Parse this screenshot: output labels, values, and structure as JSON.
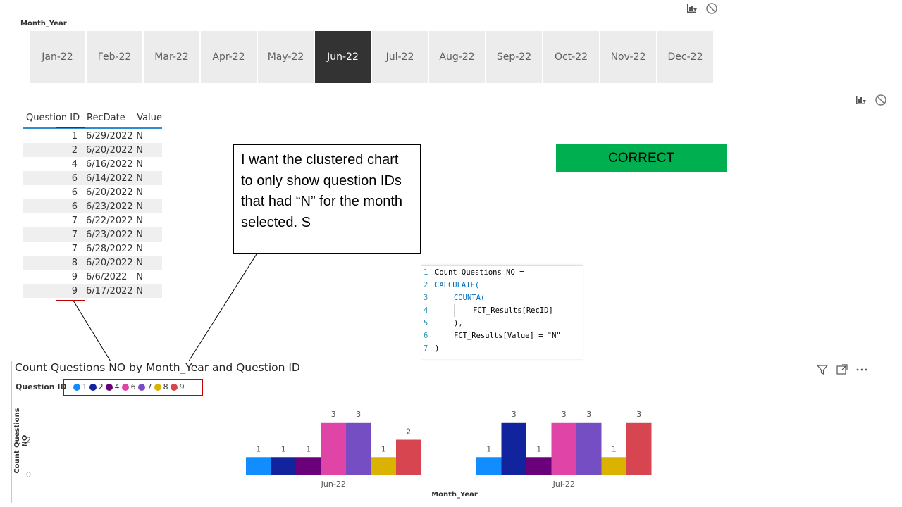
{
  "slicer": {
    "title": "Month_Year",
    "selected": "Jun-22",
    "months": [
      "Jan-22",
      "Feb-22",
      "Mar-22",
      "Apr-22",
      "May-22",
      "Jun-22",
      "Jul-22",
      "Aug-22",
      "Sep-22",
      "Oct-22",
      "Nov-22",
      "Dec-22"
    ]
  },
  "table": {
    "headers": [
      "Question ID",
      "RecDate",
      "Value"
    ],
    "rows": [
      [
        "1",
        "6/29/2022",
        "N"
      ],
      [
        "2",
        "6/20/2022",
        "N"
      ],
      [
        "4",
        "6/16/2022",
        "N"
      ],
      [
        "6",
        "6/14/2022",
        "N"
      ],
      [
        "6",
        "6/20/2022",
        "N"
      ],
      [
        "6",
        "6/23/2022",
        "N"
      ],
      [
        "7",
        "6/22/2022",
        "N"
      ],
      [
        "7",
        "6/23/2022",
        "N"
      ],
      [
        "7",
        "6/28/2022",
        "N"
      ],
      [
        "8",
        "6/20/2022",
        "N"
      ],
      [
        "9",
        "6/6/2022",
        "N"
      ],
      [
        "9",
        "6/17/2022",
        "N"
      ]
    ]
  },
  "callout": {
    "text": "I want the clustered chart to only show question IDs that had “N” for the month selected. S"
  },
  "badge": {
    "label": "CORRECT",
    "color": "#00b050"
  },
  "code": {
    "lines": [
      {
        "num": "1",
        "text": "Count Questions NO ="
      },
      {
        "num": "2",
        "text": "CALCULATE("
      },
      {
        "num": "3",
        "text": "COUNTA("
      },
      {
        "num": "4",
        "text": "FCT_Results[RecID]"
      },
      {
        "num": "5",
        "text": "),"
      },
      {
        "num": "6",
        "text": "FCT_Results[Value] = \"N\""
      },
      {
        "num": "7",
        "text": ")"
      }
    ]
  },
  "chart_panel": {
    "legend_title": "Question ID",
    "icons": [
      "filter-icon",
      "focus-mode-icon",
      "more-options-icon"
    ]
  },
  "chart_data": {
    "type": "bar",
    "title": "Count Questions NO by Month_Year and Question ID",
    "xlabel": "Month_Year",
    "ylabel": "Count Questions NO",
    "categories": [
      "Jun-22",
      "Jul-22"
    ],
    "yticks": [
      "0",
      "2"
    ],
    "ylim": [
      0,
      3.8
    ],
    "grid": false,
    "legend_position": "top-left",
    "series": [
      {
        "name": "1",
        "color": "#118dff",
        "values": [
          1,
          1
        ]
      },
      {
        "name": "2",
        "color": "#12239e",
        "values": [
          1,
          3
        ]
      },
      {
        "name": "4",
        "color": "#6b007b",
        "values": [
          1,
          1
        ]
      },
      {
        "name": "6",
        "color": "#e044a7",
        "values": [
          3,
          3
        ]
      },
      {
        "name": "7",
        "color": "#744ec2",
        "values": [
          3,
          3
        ]
      },
      {
        "name": "8",
        "color": "#d9b300",
        "values": [
          1,
          1
        ]
      },
      {
        "name": "9",
        "color": "#d64550",
        "values": [
          2,
          3
        ]
      }
    ]
  }
}
